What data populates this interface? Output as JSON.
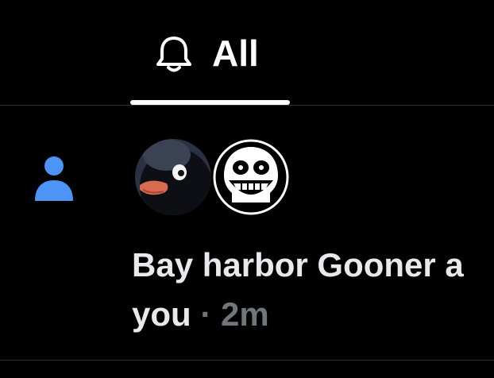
{
  "tabs": [
    {
      "label": "All",
      "icon": "bell-icon",
      "selected": true
    }
  ],
  "notification": {
    "type_icon": "person-icon",
    "type_icon_color": "#4c94f5",
    "avatars": [
      {
        "name": "avatar-penguin",
        "depicts": "penguin"
      },
      {
        "name": "avatar-skull",
        "depicts": "grinning-skull"
      }
    ],
    "text_line1": "Bay harbor Gooner a",
    "text_line2": "you",
    "separator": "·",
    "time": "2m"
  },
  "colors": {
    "background": "#000000",
    "text": "#e7e9ea",
    "muted": "#71767b",
    "divider": "#2f3336",
    "accent": "#4c94f5"
  }
}
